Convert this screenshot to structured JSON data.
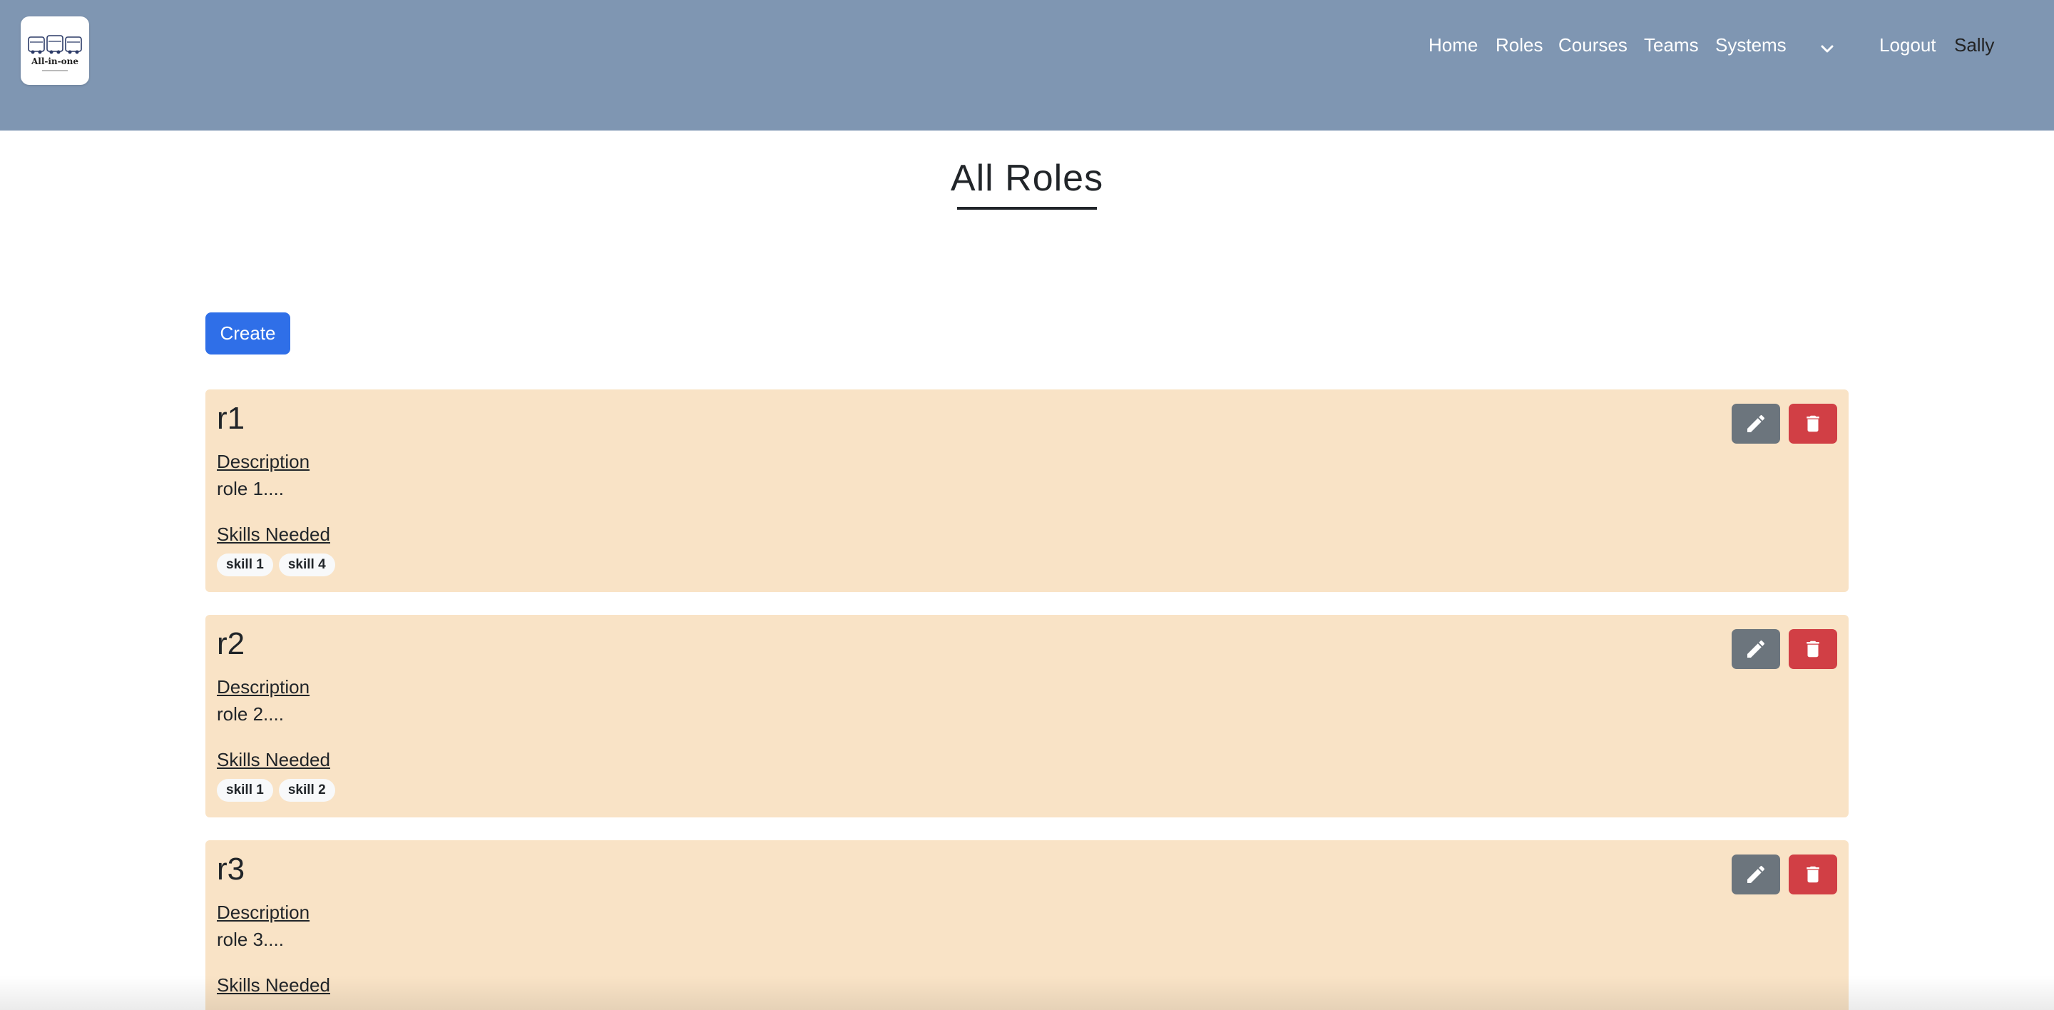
{
  "brand": {
    "logo_text": "All-in-one"
  },
  "nav": {
    "links": [
      "Home",
      "Roles",
      "Courses",
      "Teams",
      "Systems"
    ],
    "logout_label": "Logout",
    "user_name": "Sally"
  },
  "page": {
    "title": "All Roles"
  },
  "create_label": "Create",
  "labels": {
    "description": "Description",
    "skills_needed": "Skills Needed"
  },
  "roles": [
    {
      "name": "r1",
      "description": "role 1....",
      "skills": [
        "skill 1",
        "skill 4"
      ]
    },
    {
      "name": "r2",
      "description": "role 2....",
      "skills": [
        "skill 1",
        "skill 2"
      ]
    },
    {
      "name": "r3",
      "description": "role 3....",
      "skills": []
    }
  ],
  "colors": {
    "navbar": "#7f96b2",
    "card": "#f9e3c6",
    "primary": "#2f6fe8",
    "edit": "#6c757d",
    "delete": "#d13f45"
  }
}
